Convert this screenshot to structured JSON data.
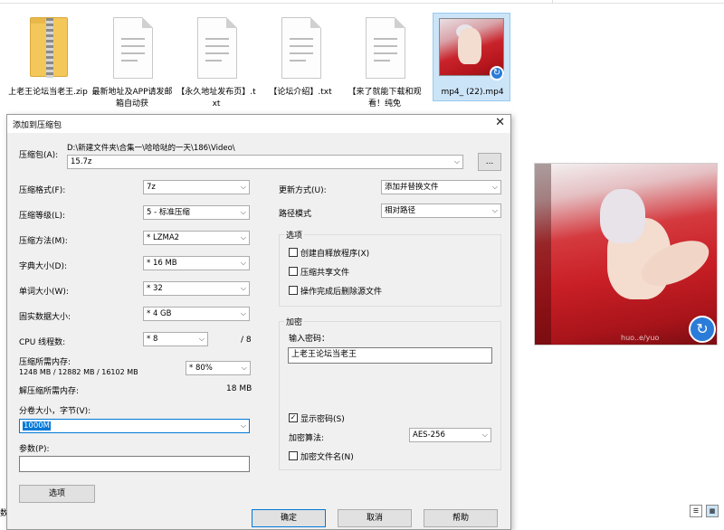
{
  "files": [
    {
      "name": "上老王论坛当老王.zip",
      "type": "zip"
    },
    {
      "name": "最新地址及APP请发邮箱自动获",
      "type": "txt"
    },
    {
      "name": "【永久地址发布页】.txt",
      "type": "txt"
    },
    {
      "name": "【论坛介绍】.txt",
      "type": "txt"
    },
    {
      "name": "【来了就能下载和观看！纯免",
      "type": "txt"
    },
    {
      "name": "mp4_ (22).mp4",
      "type": "video"
    }
  ],
  "dialog": {
    "title": "添加到压缩包",
    "archive_label": "压缩包(A):",
    "archive_path": "D:\\新建文件夹\\合集一\\哈哈哒的一天\\186\\Video\\",
    "archive_name": "15.7z",
    "browse_label": "...",
    "format_label": "压缩格式(F):",
    "format_value": "7z",
    "level_label": "压缩等级(L):",
    "level_value": "5 - 标准压缩",
    "method_label": "压缩方法(M):",
    "method_value": "* LZMA2",
    "dict_label": "字典大小(D):",
    "dict_value": "* 16 MB",
    "word_label": "单词大小(W):",
    "word_value": "* 32",
    "solid_label": "固实数据大小:",
    "solid_value": "* 4 GB",
    "cpu_label": "CPU 线程数:",
    "cpu_value": "* 8",
    "cpu_total": "/ 8",
    "mem_label": "压缩所需内存:",
    "mem_detail": "1248 MB / 12882 MB / 16102 MB",
    "mem_value": "* 80%",
    "decomp_label": "解压缩所需内存:",
    "decomp_value": "18 MB",
    "split_label": "分卷大小，字节(V):",
    "split_value": "1000M",
    "params_label": "参数(P):",
    "params_value": "",
    "options_button": "选项",
    "update_label": "更新方式(U):",
    "update_value": "添加并替换文件",
    "path_label": "路径模式",
    "path_value": "相对路径",
    "options_group": "选项",
    "opt_sfx": "创建自释放程序(X)",
    "opt_shared": "压缩共享文件",
    "opt_delete": "操作完成后删除源文件",
    "encrypt_group": "加密",
    "password_label": "输入密码：",
    "password_value": "上老王论坛当老王",
    "show_password": "显示密码(S)",
    "algo_label": "加密算法:",
    "algo_value": "AES-256",
    "encrypt_names": "加密文件名(N)",
    "ok_button": "确定",
    "cancel_button": "取消",
    "help_button": "帮助"
  },
  "preview": {
    "watermark": "huo..e/yuo"
  },
  "status": {
    "left_text": "数"
  }
}
